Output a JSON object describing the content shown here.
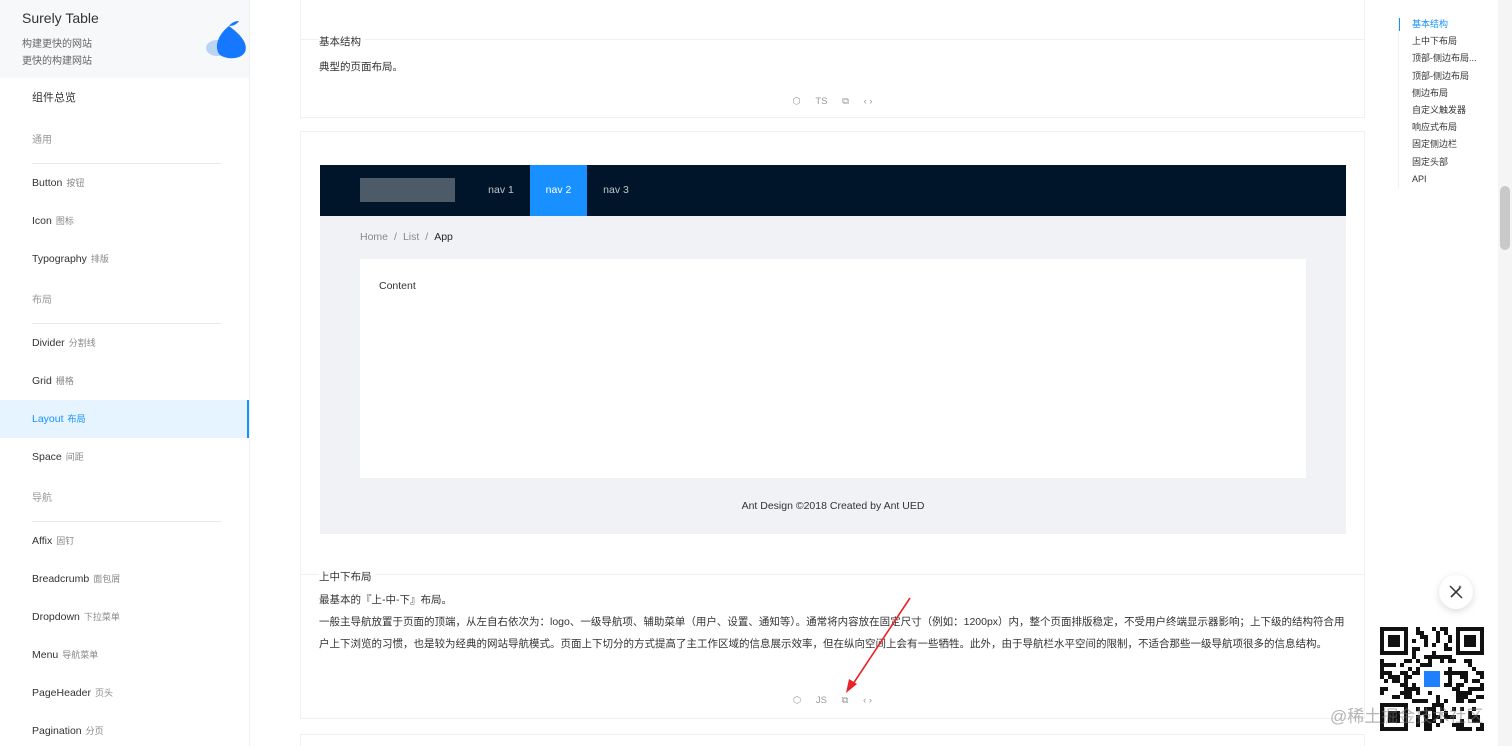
{
  "brand": {
    "title": "Surely Table",
    "subtitle1": "构建更快的网站",
    "subtitle2": "更快的构建网站"
  },
  "sidebar": {
    "overview": "组件总览",
    "items": [
      {
        "type": "group",
        "label": "通用"
      },
      {
        "type": "item",
        "en": "Button",
        "zh": "按钮"
      },
      {
        "type": "item",
        "en": "Icon",
        "zh": "图标"
      },
      {
        "type": "item",
        "en": "Typography",
        "zh": "排版"
      },
      {
        "type": "group",
        "label": "布局"
      },
      {
        "type": "item",
        "en": "Divider",
        "zh": "分割线"
      },
      {
        "type": "item",
        "en": "Grid",
        "zh": "栅格"
      },
      {
        "type": "item",
        "en": "Layout",
        "zh": "布局",
        "active": true
      },
      {
        "type": "item",
        "en": "Space",
        "zh": "间距"
      },
      {
        "type": "group",
        "label": "导航"
      },
      {
        "type": "item",
        "en": "Affix",
        "zh": "固钉"
      },
      {
        "type": "item",
        "en": "Breadcrumb",
        "zh": "面包屑"
      },
      {
        "type": "item",
        "en": "Dropdown",
        "zh": "下拉菜单"
      },
      {
        "type": "item",
        "en": "Menu",
        "zh": "导航菜单"
      },
      {
        "type": "item",
        "en": "PageHeader",
        "zh": "页头"
      },
      {
        "type": "item",
        "en": "Pagination",
        "zh": "分页"
      }
    ]
  },
  "card1": {
    "title": "基本结构",
    "description": "典型的页面布局。",
    "actions": {
      "sandbox": "⬡",
      "lang": "TS",
      "copy": "⧉",
      "code": "‹ ›"
    }
  },
  "demo": {
    "nav": [
      "nav 1",
      "nav 2",
      "nav 3"
    ],
    "active_nav": "nav 2",
    "breadcrumb": [
      "Home",
      "List",
      "App"
    ],
    "separator": "/",
    "content": "Content",
    "footer": "Ant Design ©2018 Created by Ant UED"
  },
  "card2": {
    "title": "上中下布局",
    "desc_line1": "最基本的『上-中-下』布局。",
    "desc_para": "一般主导航放置于页面的顶端，从左自右依次为：logo、一级导航项、辅助菜单（用户、设置、通知等）。通常将内容放在固定尺寸（例如：1200px）内，整个页面排版稳定，不受用户终端显示器影响；上下级的结构符合用户上下浏览的习惯，也是较为经典的网站导航模式。页面上下切分的方式提高了主工作区域的信息展示效率，但在纵向空间上会有一些牺牲。此外，由于导航栏水平空间的限制，不适合那些一级导航项很多的信息结构。",
    "actions": {
      "sandbox": "⬡",
      "lang": "JS",
      "copy": "⧉",
      "code": "‹ ›"
    }
  },
  "toc": [
    {
      "label": "基本结构",
      "active": true
    },
    {
      "label": "上中下布局"
    },
    {
      "label": "顶部-侧边布局..."
    },
    {
      "label": "顶部-侧边布局"
    },
    {
      "label": "侧边布局"
    },
    {
      "label": "自定义触发器"
    },
    {
      "label": "响应式布局"
    },
    {
      "label": "固定侧边栏"
    },
    {
      "label": "固定头部"
    },
    {
      "label": "API"
    }
  ],
  "watermark": "@稀土掘金技术社区",
  "colors": {
    "primary": "#1890ff",
    "header": "#001529",
    "arrow": "#e8232a"
  }
}
